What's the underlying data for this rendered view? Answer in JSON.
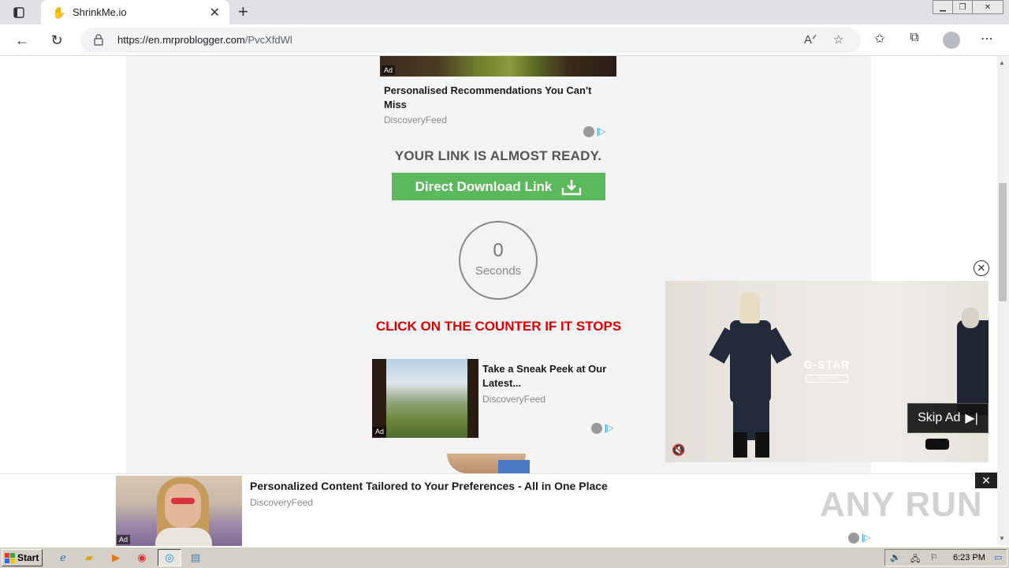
{
  "browser": {
    "tab_title": "ShrinkMe.io",
    "tab_favicon": "hand-icon",
    "new_tab_symbol": "+",
    "close_tab_symbol": "✕",
    "url_host": "https://en.mrproblogger.com",
    "url_path": "/PvcXfdWl"
  },
  "page": {
    "ad1": {
      "tag": "Ad",
      "title": "Personalised Recommendations You Can't Miss",
      "source": "DiscoveryFeed"
    },
    "ready_text": "YOUR LINK IS ALMOST READY.",
    "download_label": "Direct Download Link",
    "counter": {
      "value": "0",
      "label": "Seconds"
    },
    "counter_hint": "CLICK ON THE COUNTER IF IT STOPS",
    "ad2": {
      "tag": "Ad",
      "title": "Take a Sneak Peek at Our Latest...",
      "source": "DiscoveryFeed"
    }
  },
  "video_ad": {
    "brand": "G-STAR",
    "brand_sub": "shop now",
    "skip_label": "Skip Ad"
  },
  "bottom_ad": {
    "tag": "Ad",
    "title": "Personalized Content Tailored to Your Preferences - All in One Place",
    "source": "DiscoveryFeed",
    "watermark": "ANY RUN"
  },
  "taskbar": {
    "start_label": "Start",
    "clock": "6:23 PM"
  },
  "colors": {
    "download_green": "#5cb85c",
    "counter_hint_red": "#dd0000",
    "adchoice_blue": "#3aa0d8"
  }
}
